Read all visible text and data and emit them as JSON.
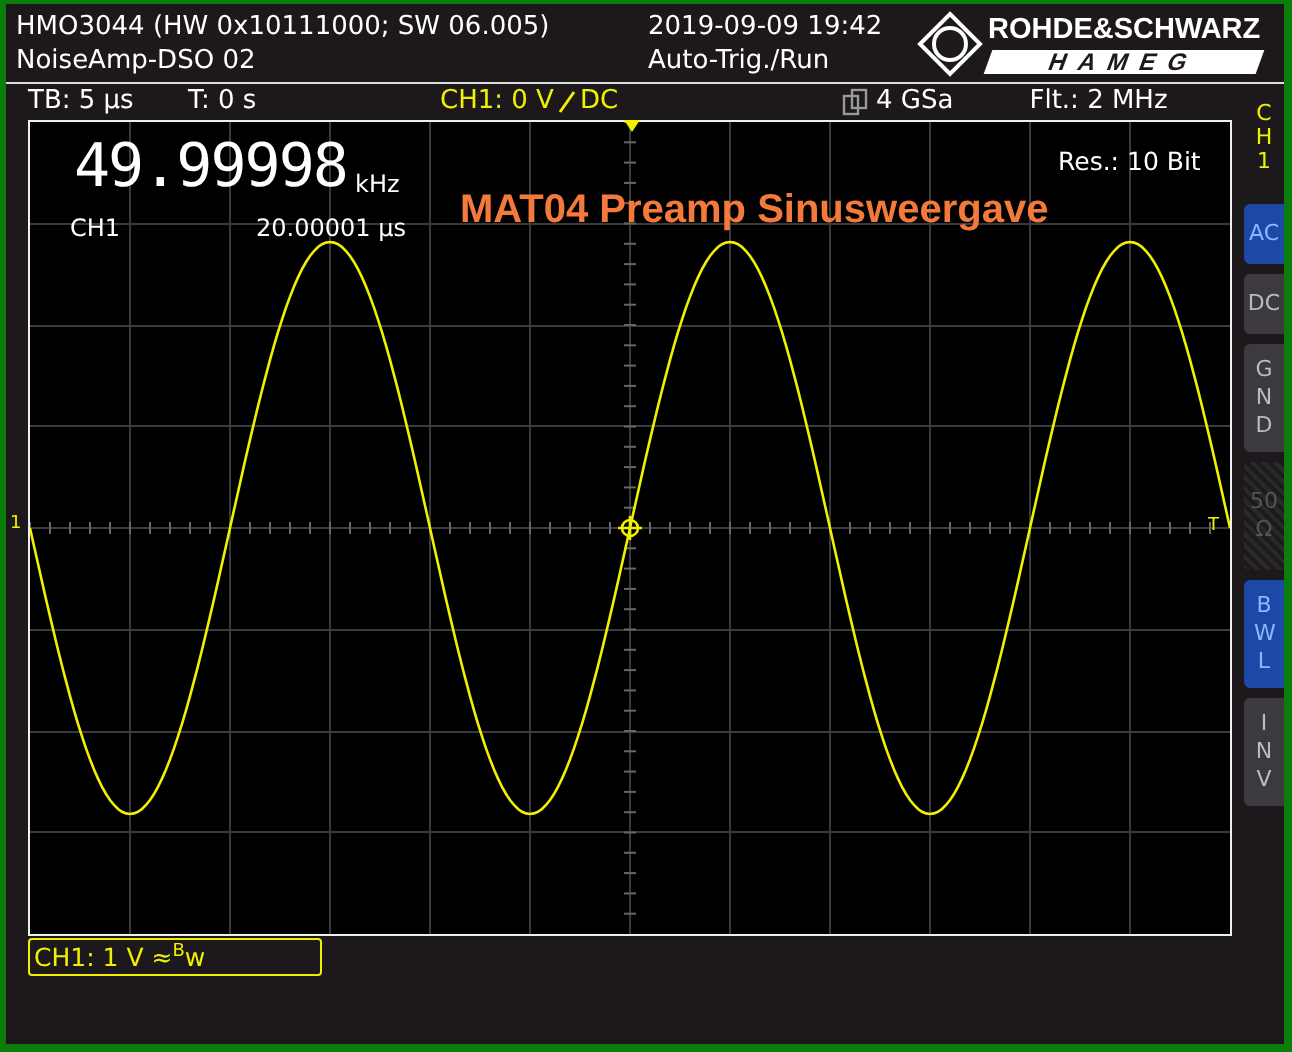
{
  "header": {
    "device": "HMO3044 (HW 0x10111000; SW 06.005)",
    "setup": "NoiseAmp-DSO 02",
    "datetime": "2019-09-09 19:42",
    "mode": "Auto-Trig./Run",
    "brand_top": "ROHDE&SCHWARZ",
    "brand_bottom": "HAMEG"
  },
  "status": {
    "timebase": "TB: 5 µs",
    "trigger_time": "T: 0 s",
    "trigger_level": "CH1: 0 V",
    "trigger_coupling": "DC",
    "sample_rate": "4 GSa",
    "filter": "Flt.: 2 MHz"
  },
  "display": {
    "frequency": "49.99998",
    "frequency_unit": "kHz",
    "channel": "CH1",
    "period": "20.00001 µs",
    "resolution": "Res.: 10 Bit",
    "annotation": "MAT04 Preamp Sinusweergave",
    "channel_marker": "1",
    "trigger_marker": "T"
  },
  "side_panel": {
    "channel": "CH1",
    "buttons": [
      {
        "label": "AC",
        "kind": "row",
        "selected": true,
        "disabled": false
      },
      {
        "label": "DC",
        "kind": "row",
        "selected": false,
        "disabled": false
      },
      {
        "label": "GND",
        "kind": "column",
        "selected": false,
        "disabled": false
      },
      {
        "label": "50 Ω",
        "kind": "stacked",
        "selected": false,
        "disabled": true
      },
      {
        "label": "BWL",
        "kind": "column",
        "selected": true,
        "disabled": false
      },
      {
        "label": "INV",
        "kind": "column",
        "selected": false,
        "disabled": false
      }
    ]
  },
  "channel_info": "CH1: 1 V ≈$^{B}$w"
}
